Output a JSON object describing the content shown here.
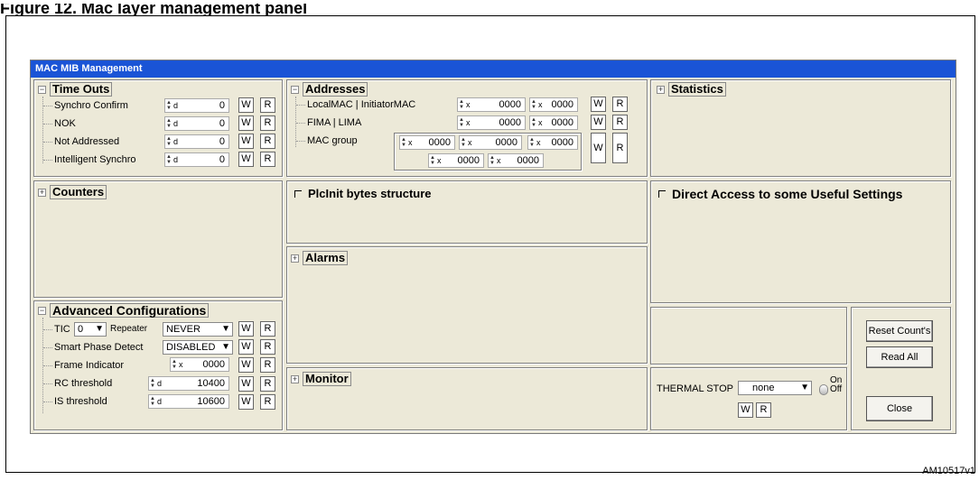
{
  "caption": "Figure 12. Mac layer management panel",
  "window": {
    "title": "MAC MIB Management"
  },
  "time_outs": {
    "title": "Time Outs",
    "rows": [
      {
        "label": "Synchro Confirm",
        "prefix": "d",
        "value": "0"
      },
      {
        "label": "NOK",
        "prefix": "d",
        "value": "0"
      },
      {
        "label": "Not Addressed",
        "prefix": "d",
        "value": "0"
      },
      {
        "label": "Intelligent Synchro",
        "prefix": "d",
        "value": "0"
      }
    ]
  },
  "addresses": {
    "title": "Addresses",
    "rows": [
      {
        "label": "LocalMAC | InitiatorMAC",
        "prefix": "x",
        "values": [
          "0000",
          "0000"
        ]
      },
      {
        "label": "FIMA | LIMA",
        "prefix": "x",
        "values": [
          "0000",
          "0000"
        ]
      },
      {
        "label": "MAC group",
        "prefix": "x",
        "values": [
          "0000",
          "0000",
          "0000",
          "0000",
          "0000"
        ]
      }
    ]
  },
  "statistics": {
    "title": "Statistics"
  },
  "counters": {
    "title": "Counters"
  },
  "plcinit": {
    "title": "PlcInit bytes structure"
  },
  "direct_access": {
    "title": "Direct Access to some Useful Settings"
  },
  "alarms": {
    "title": "Alarms"
  },
  "monitor": {
    "title": "Monitor"
  },
  "advanced": {
    "title": "Advanced Configurations",
    "tic_label": "TIC",
    "tic_value": "0",
    "repeater_label": "Repeater",
    "repeater_value": "NEVER",
    "smart_phase_label": "Smart Phase Detect",
    "smart_phase_value": "DISABLED",
    "frame_indicator_label": "Frame Indicator",
    "frame_indicator_prefix": "x",
    "frame_indicator_value": "0000",
    "rc_threshold_label": "RC threshold",
    "rc_threshold_prefix": "d",
    "rc_threshold_value": "10400",
    "is_threshold_label": "IS threshold",
    "is_threshold_prefix": "d",
    "is_threshold_value": "10600"
  },
  "buttons": {
    "write": "W",
    "read": "R",
    "reset_counts": "Reset Count's",
    "read_all": "Read All",
    "close": "Close"
  },
  "thermal": {
    "label": "THERMAL STOP",
    "value": "none",
    "on": "On",
    "off": "Off"
  },
  "figure_ref": "AM10517v1"
}
